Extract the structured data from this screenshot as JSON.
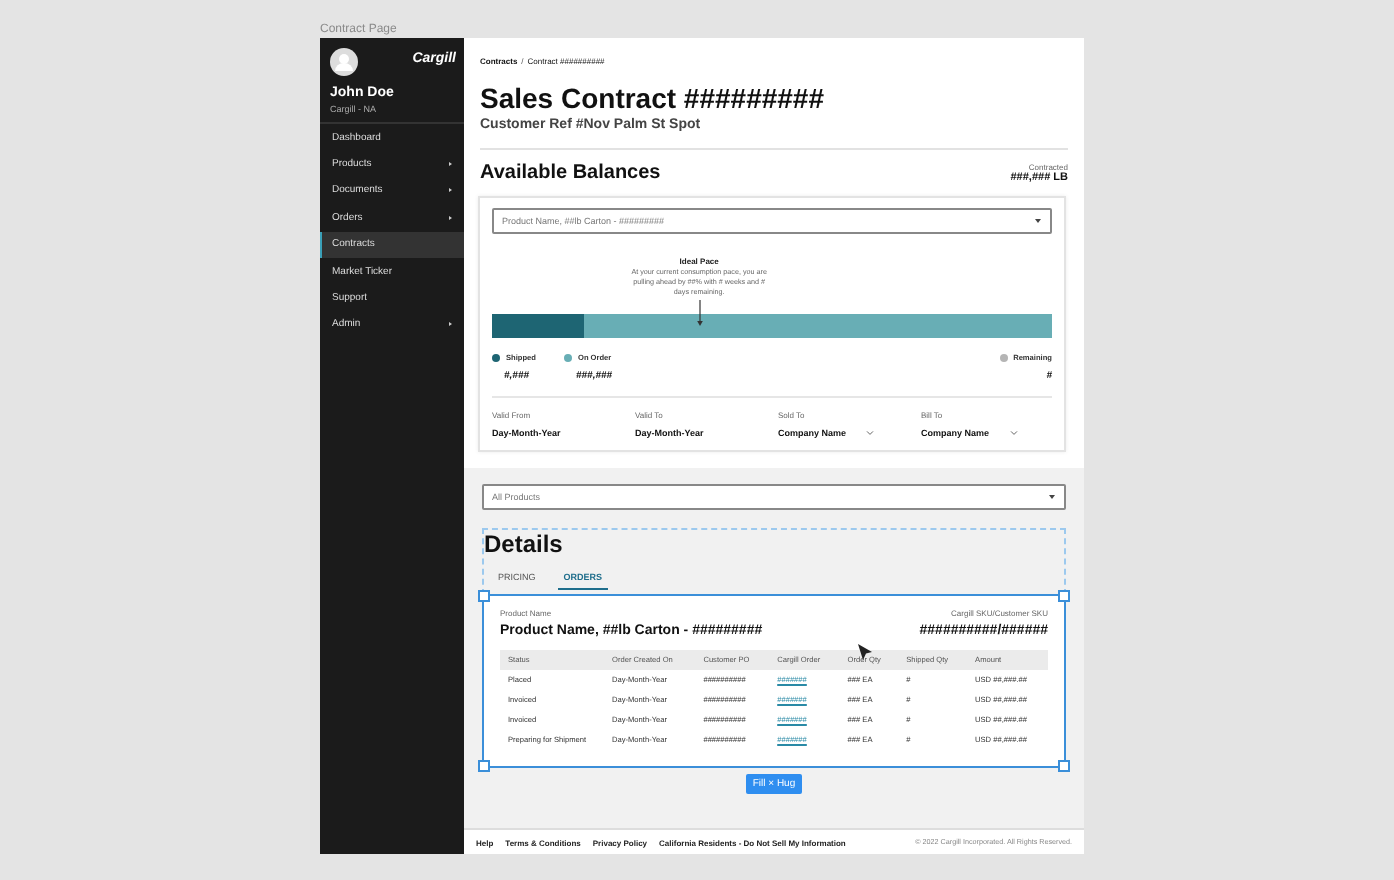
{
  "canvas": {
    "frame_label": "Contract Page"
  },
  "sidebar": {
    "user": {
      "name": "John Doe",
      "org": "Cargill - NA"
    },
    "logo": "Cargill",
    "items": [
      {
        "label": "Dashboard",
        "selected": false,
        "submenu": false
      },
      {
        "label": "Products",
        "selected": false,
        "submenu": true
      },
      {
        "label": "Documents",
        "selected": false,
        "submenu": true
      },
      {
        "label": "Orders",
        "selected": false,
        "submenu": true
      },
      {
        "label": "Contracts",
        "selected": true,
        "submenu": false
      },
      {
        "label": "Market Ticker",
        "selected": false,
        "submenu": false
      },
      {
        "label": "Support",
        "selected": false,
        "submenu": false
      },
      {
        "label": "Admin",
        "selected": false,
        "submenu": true
      }
    ]
  },
  "breadcrumb": [
    "Contracts",
    "/",
    "Contract ##########"
  ],
  "title": "Sales Contract #########",
  "subtitle": "Customer Ref #Nov Palm St Spot",
  "balances": {
    "heading": "Available Balances",
    "contracted_label": "Contracted",
    "contracted_value": "###,### LB",
    "product_select": "Product Name, ##lb Carton - #########",
    "pace": {
      "title": "Ideal Pace",
      "text": "At your current consumption pace, you are pulling ahead by ##% with # weeks and # days remaining.",
      "level": 0.37
    },
    "bar": {
      "level": 0.163
    },
    "legend": [
      {
        "label": "Shipped",
        "value": "#,###",
        "color": "#1e6573"
      },
      {
        "label": "On Order",
        "value": "###,###",
        "color": "#68aeb5"
      },
      {
        "label": "Remaining",
        "value": "#",
        "color": "#b5b5b5"
      }
    ],
    "fields": [
      {
        "label": "Valid From",
        "value": "Day-Month-Year",
        "dropdown": false
      },
      {
        "label": "Valid To",
        "value": "Day-Month-Year",
        "dropdown": false
      },
      {
        "label": "Sold To",
        "value": "Company Name",
        "dropdown": true
      },
      {
        "label": "Bill To",
        "value": "Company Name",
        "dropdown": true
      }
    ]
  },
  "details": {
    "filter": "All Products",
    "heading": "Details",
    "tabs": [
      {
        "label": "PRICING",
        "selected": false
      },
      {
        "label": "ORDERS",
        "selected": true
      }
    ],
    "product_label": "Product Name",
    "product_name": "Product Name, ##lb Carton - #########",
    "sku_label": "Cargill SKU/Customer SKU",
    "sku_value": "##########/######",
    "columns": [
      "Status",
      "Order Created On",
      "Customer PO",
      "Cargill Order",
      "Order Qty",
      "Shipped Qty",
      "Amount"
    ],
    "rows": [
      [
        "Placed",
        "Day-Month-Year",
        "##########",
        "#######",
        "### EA",
        "#",
        "USD ##,###.##"
      ],
      [
        "Invoiced",
        "Day-Month-Year",
        "##########",
        "#######",
        "### EA",
        "#",
        "USD ##,###.##"
      ],
      [
        "Invoiced",
        "Day-Month-Year",
        "##########",
        "#######",
        "### EA",
        "#",
        "USD ##,###.##"
      ],
      [
        "Preparing for Shipment",
        "Day-Month-Year",
        "##########",
        "#######",
        "### EA",
        "#",
        "USD ##,###.##"
      ]
    ],
    "sizing_badge": "Fill × Hug"
  },
  "footer": {
    "links": [
      "Help",
      "Terms & Conditions",
      "Privacy Policy",
      "California Residents - Do Not Sell My Information"
    ],
    "copyright": "© 2022 Cargill Incorporated. All Rights Reserved."
  }
}
